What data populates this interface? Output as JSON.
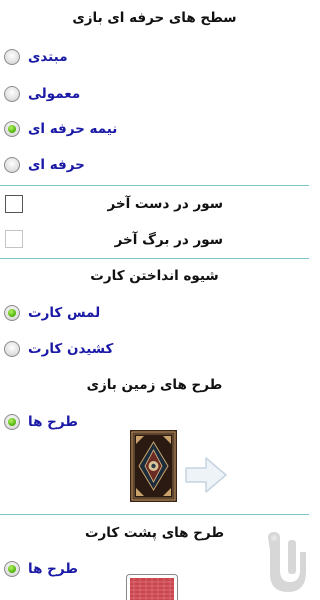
{
  "game_levels": {
    "title": "سطح های حرفه ای بازی",
    "options": [
      {
        "label": "مبتدی",
        "selected": false
      },
      {
        "label": "معمولی",
        "selected": false
      },
      {
        "label": "نیمه حرفه ای",
        "selected": true
      },
      {
        "label": "حرفه ای",
        "selected": false
      }
    ]
  },
  "checkboxes": [
    {
      "label": "سور در دست آخر",
      "checked": false,
      "enabled": true
    },
    {
      "label": "سور در برگ آخر",
      "checked": false,
      "enabled": false
    }
  ],
  "card_throw": {
    "title": "شیوه انداختن کارت",
    "options": [
      {
        "label": "لمس کارت",
        "selected": true
      },
      {
        "label": "کشیدن کارت",
        "selected": false
      }
    ]
  },
  "table_designs": {
    "title": "طرح های زمین بازی",
    "option_label": "طرح ها",
    "selected": true,
    "preview_icon": "carpet-pattern-thumbnail",
    "next_icon": "arrow-right-icon"
  },
  "card_back_designs": {
    "title": "طرح های پشت کارت",
    "option_label": "طرح ها",
    "selected": true,
    "preview_icon": "card-back-thumbnail"
  },
  "colors": {
    "option_text": "#1a1aa6",
    "divider": "#7fc5cc",
    "radio_selected": "#5fbf14",
    "card_back": "#c9464f"
  }
}
